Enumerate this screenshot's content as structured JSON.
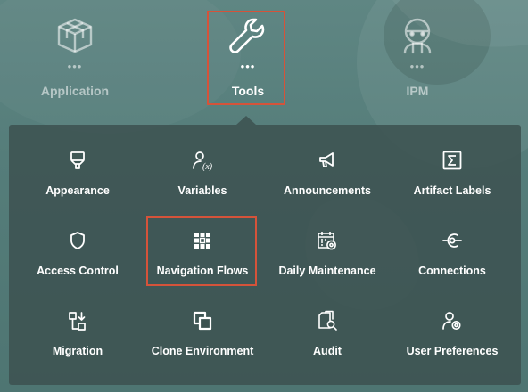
{
  "nav": {
    "items": [
      {
        "label": "Application",
        "icon": "cube-icon",
        "state": "inactive"
      },
      {
        "label": "Tools",
        "icon": "wrench-icon",
        "state": "active"
      },
      {
        "label": "IPM",
        "icon": "robot-icon",
        "state": "inactive"
      }
    ],
    "dots": "•••"
  },
  "tools": {
    "cards": [
      {
        "label": "Appearance",
        "icon": "paint-brush-icon"
      },
      {
        "label": "Variables",
        "icon": "person-variable-icon"
      },
      {
        "label": "Announcements",
        "icon": "megaphone-icon"
      },
      {
        "label": "Artifact Labels",
        "icon": "sigma-icon"
      },
      {
        "label": "Access Control",
        "icon": "shield-icon"
      },
      {
        "label": "Navigation Flows",
        "icon": "grid-icon",
        "highlighted": true
      },
      {
        "label": "Daily Maintenance",
        "icon": "calendar-gear-icon"
      },
      {
        "label": "Connections",
        "icon": "plug-icon"
      },
      {
        "label": "Migration",
        "icon": "migration-icon"
      },
      {
        "label": "Clone Environment",
        "icon": "clone-icon"
      },
      {
        "label": "Audit",
        "icon": "audit-icon"
      },
      {
        "label": "User Preferences",
        "icon": "user-gear-icon"
      }
    ]
  },
  "colors": {
    "highlight_border": "#d5533a",
    "panel_background": "#3c5250",
    "background": "#5a817e"
  }
}
